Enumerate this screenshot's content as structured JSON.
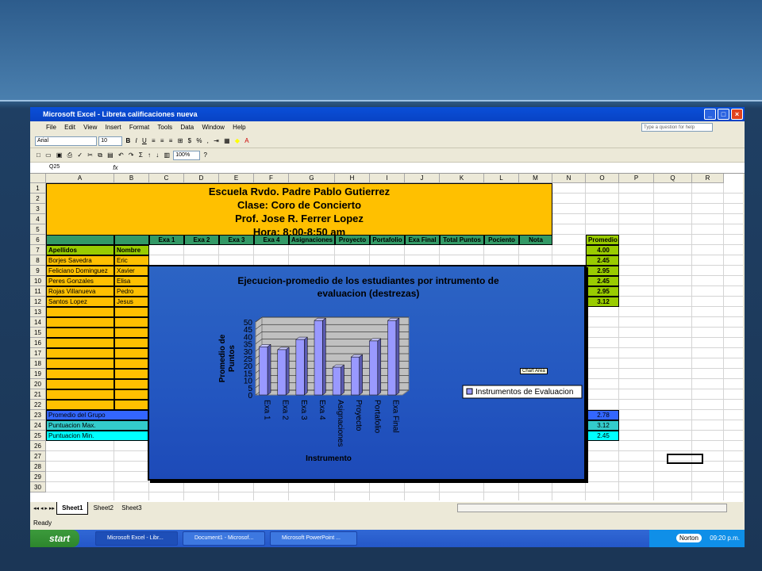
{
  "window": {
    "title": "Microsoft Excel - Libreta calificaciones nueva",
    "help_placeholder": "Type a question for help"
  },
  "menu": [
    "File",
    "Edit",
    "View",
    "Insert",
    "Format",
    "Tools",
    "Data",
    "Window",
    "Help"
  ],
  "toolbar": {
    "font": "Arial",
    "size": "10",
    "zoom": "100%"
  },
  "formula": {
    "name_box": "Q25",
    "fx": "fx"
  },
  "columns": [
    "A",
    "B",
    "C",
    "D",
    "E",
    "F",
    "G",
    "H",
    "I",
    "J",
    "K",
    "L",
    "M",
    "N",
    "O",
    "P",
    "Q",
    "R"
  ],
  "rows": [
    "1",
    "2",
    "3",
    "4",
    "5",
    "6",
    "7",
    "8",
    "9",
    "10",
    "11",
    "12",
    "13",
    "14",
    "15",
    "16",
    "17",
    "18",
    "19",
    "20",
    "21",
    "22",
    "23",
    "24",
    "25",
    "26",
    "27",
    "28",
    "29",
    "30"
  ],
  "header_lines": [
    "Escuela Rvdo. Padre Pablo Gutierrez",
    "Clase: Coro de Concierto",
    "Prof. Jose R. Ferrer Lopez",
    "Hora: 8:00-8:50 am"
  ],
  "row6": [
    "Exa 1",
    "Exa 2",
    "Exa 3",
    "Exa 4",
    "Asignaciones",
    "Proyecto",
    "Portafolio",
    "Exa Final",
    "Total Puntos",
    "Pociento",
    "Nota"
  ],
  "promedio_header": "Promedio",
  "col_a7": "Apellidos",
  "col_b7": "Nombre",
  "students": [
    {
      "apellido": "Borjes Savedra",
      "nombre": "Eric",
      "promedio": "2.45"
    },
    {
      "apellido": "Feliciano Dominguez",
      "nombre": "Xavier",
      "promedio": "2.95"
    },
    {
      "apellido": "Peres Gonzales",
      "nombre": "Elisa",
      "promedio": "2.45"
    },
    {
      "apellido": "Rojas Villanueva",
      "nombre": "Pedro",
      "promedio": "2.95"
    },
    {
      "apellido": "Santos Lopez",
      "nombre": "Jesus",
      "promedio": "3.12"
    }
  ],
  "o7": "4.00",
  "summary": [
    {
      "label": "Promedio del  Grupo",
      "value": "2.78"
    },
    {
      "label": "Puntuacion Max.",
      "value": "3.12"
    },
    {
      "label": "Puntuacion Min.",
      "value": "2.45"
    }
  ],
  "sheets": [
    "Sheet1",
    "Sheet2",
    "Sheet3"
  ],
  "status": "Ready",
  "taskbar": {
    "start": "start",
    "tasks": [
      "Microsoft Excel - Libr...",
      "Document1 - Microsof...",
      "Microsoft PowerPoint ..."
    ],
    "tray_app": "Norton",
    "time": "09:20 p.m."
  },
  "chart_tooltip": "Chart Area",
  "colors": {
    "header_yellow": "#ffc000",
    "green": "#339966",
    "lime": "#99cc00",
    "blue": "#3366ff",
    "cyan": "#33cccc",
    "chart_bg": "#2356c0",
    "bar": "#9999ff"
  },
  "chart_data": {
    "type": "bar",
    "title": "Ejecucion-promedio de los estudiantes por intrumento de evaluacion (destrezas)",
    "xlabel": "Instrumento",
    "ylabel": "Promedio de Puntos",
    "categories": [
      "Exa 1",
      "Exa 2",
      "Exa 3",
      "Exa 4",
      "Asignaciones",
      "Proyecto",
      "Portafolio",
      "Exa Final"
    ],
    "series": [
      {
        "name": "Instrumentos de Evaluacion",
        "values": [
          33,
          31,
          38,
          51,
          19,
          26,
          37,
          51
        ]
      }
    ],
    "ylim": [
      0,
      50
    ],
    "yticks": [
      "0",
      "5",
      "10",
      "15",
      "20",
      "25",
      "30",
      "35",
      "40",
      "45",
      "50"
    ],
    "legend": "right",
    "grid": true
  }
}
